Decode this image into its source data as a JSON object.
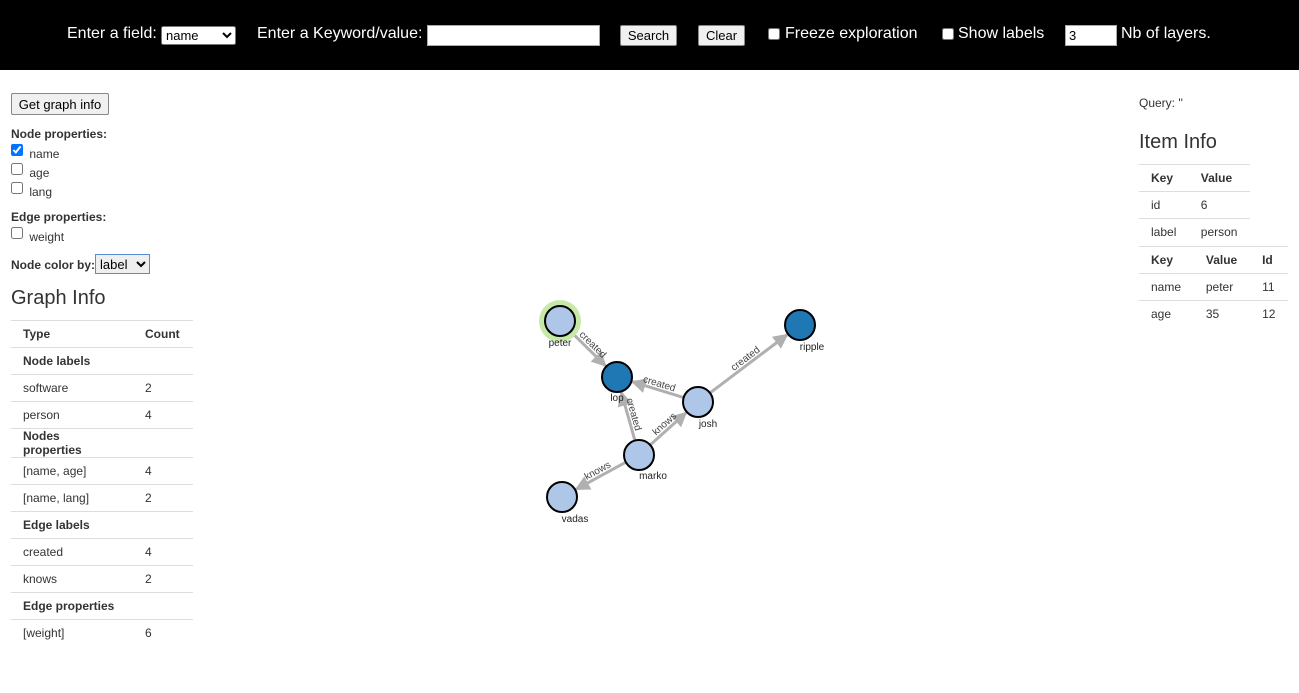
{
  "toolbar": {
    "field_label": "Enter a field:",
    "field_value": "name",
    "keyword_label": "Enter a Keyword/value:",
    "keyword_value": "",
    "search_label": "Search",
    "clear_label": "Clear",
    "freeze_label": "Freeze exploration",
    "freeze_checked": false,
    "show_labels_label": "Show labels",
    "show_labels_checked": false,
    "layers_value": "3",
    "layers_label": "Nb of layers."
  },
  "left": {
    "get_info_label": "Get graph info",
    "node_props_title": "Node properties:",
    "node_props": [
      {
        "label": "name",
        "checked": true
      },
      {
        "label": "age",
        "checked": false
      },
      {
        "label": "lang",
        "checked": false
      }
    ],
    "edge_props_title": "Edge properties:",
    "edge_props": [
      {
        "label": "weight",
        "checked": false
      }
    ],
    "color_by_label": "Node color by:",
    "color_by_value": "label",
    "graph_info_title": "Graph Info",
    "graph_info": {
      "headers": [
        "Type",
        "Count"
      ],
      "rows": [
        {
          "type": "Node labels",
          "count": "",
          "section": true
        },
        {
          "type": "software",
          "count": "2"
        },
        {
          "type": "person",
          "count": "4"
        },
        {
          "type": "Nodes properties",
          "count": "",
          "section": true
        },
        {
          "type": "[name, age]",
          "count": "4"
        },
        {
          "type": "[name, lang]",
          "count": "2"
        },
        {
          "type": "Edge labels",
          "count": "",
          "section": true
        },
        {
          "type": "created",
          "count": "4"
        },
        {
          "type": "knows",
          "count": "2"
        },
        {
          "type": "Edge properties",
          "count": "",
          "section": true
        },
        {
          "type": "[weight]",
          "count": "6"
        }
      ]
    }
  },
  "right": {
    "query_text": "Query: ''",
    "item_info_title": "Item Info",
    "kv_headers": [
      "Key",
      "Value"
    ],
    "kv_rows": [
      {
        "key": "id",
        "value": "6"
      },
      {
        "key": "label",
        "value": "person"
      }
    ],
    "prop_headers": [
      "Key",
      "Value",
      "Id"
    ],
    "prop_rows": [
      {
        "key": "name",
        "value": "peter",
        "id": "11"
      },
      {
        "key": "age",
        "value": "35",
        "id": "12"
      }
    ]
  },
  "graph": {
    "colors": {
      "person": "#aec7e8",
      "software": "#1f77b4",
      "highlight": "#c7e9a8",
      "edge": "#b0b0b0"
    },
    "nodes": [
      {
        "name": "peter",
        "type": "person",
        "selected": true
      },
      {
        "name": "lop",
        "type": "software"
      },
      {
        "name": "ripple",
        "type": "software"
      },
      {
        "name": "josh",
        "type": "person"
      },
      {
        "name": "marko",
        "type": "person"
      },
      {
        "name": "vadas",
        "type": "person"
      }
    ],
    "edges": [
      {
        "from": "peter",
        "to": "lop",
        "label": "created"
      },
      {
        "from": "josh",
        "to": "lop",
        "label": "created"
      },
      {
        "from": "josh",
        "to": "ripple",
        "label": "created"
      },
      {
        "from": "marko",
        "to": "lop",
        "label": "created"
      },
      {
        "from": "marko",
        "to": "josh",
        "label": "knows"
      },
      {
        "from": "marko",
        "to": "vadas",
        "label": "knows"
      }
    ]
  }
}
